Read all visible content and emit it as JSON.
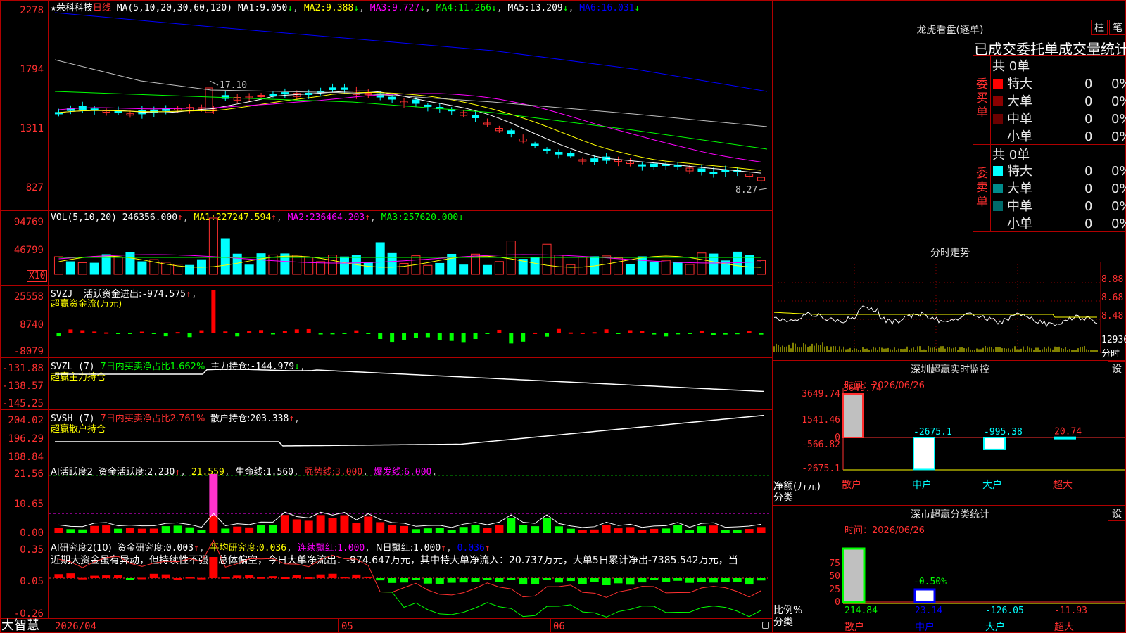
{
  "colors": {
    "up": "#ff3030",
    "down": "#00ffff",
    "flow_up": "#ff0000",
    "flow_down": "#00ff00",
    "ma1": "#ffffff",
    "ma2": "#ffff00",
    "ma3": "#ff00ff",
    "ma4": "#00ff00",
    "ma5": "#c0c0c0",
    "ma6": "#0000ff",
    "frame": "#b00000"
  },
  "kline": {
    "star": "★",
    "stock_name": "荣科科技",
    "period": "日线",
    "ma_title": "MA(5,10,20,30,60,120)",
    "ma": [
      {
        "label": "MA1:",
        "value": "9.050",
        "dir": "↓"
      },
      {
        "label": "MA2:",
        "value": "9.388",
        "dir": "↓"
      },
      {
        "label": "MA3:",
        "value": "9.727",
        "dir": "↓"
      },
      {
        "label": "MA4:",
        "value": "11.266",
        "dir": "↓"
      },
      {
        "label": "MA5:",
        "value": "13.209",
        "dir": "↓"
      },
      {
        "label": "MA6:",
        "value": "16.031",
        "dir": "↓"
      }
    ],
    "y_ticks": [
      "2278",
      "1794",
      "1311",
      "827"
    ],
    "annot_high": "17.10",
    "annot_low": "8.27"
  },
  "vol": {
    "title": "VOL(5,10,20)",
    "value": "246356.000",
    "dir": "↑",
    "ma": [
      {
        "label": "MA1:",
        "value": "227247.594",
        "dir": "↑"
      },
      {
        "label": "MA2:",
        "value": "236464.203",
        "dir": "↑"
      },
      {
        "label": "MA3:",
        "value": "257620.000",
        "dir": "↓"
      }
    ],
    "y_ticks": [
      "94769",
      "46799"
    ],
    "unit": "X10"
  },
  "svzj": {
    "title": "SVZJ",
    "name": "活跃资金进出:",
    "value": "-974.575",
    "dir": "↑",
    "subtitle": "超赢资金流(万元)",
    "y_ticks": [
      "25558",
      "8740",
      "-8079"
    ]
  },
  "svzl": {
    "title": "SVZL (7)",
    "l1": "7日内买卖净占比1.662%",
    "l2": "主力持仓:",
    "v2": "-144.979",
    "dir": "↓",
    "subtitle": "超赢主力持仓",
    "y_ticks": [
      "-131.88",
      "-138.57",
      "-145.25"
    ]
  },
  "svsh": {
    "title": "SVSH (7)",
    "l1": "7日内买卖净占比2.761%",
    "l2": "散户持仓:",
    "v2": "203.338",
    "dir": "↑",
    "subtitle": "超赢散户持仓",
    "y_ticks": [
      "204.02",
      "196.29",
      "188.84"
    ]
  },
  "ai_active": {
    "title": "AI活跃度2",
    "l1": "资金活跃度:",
    "v1": "2.230",
    "d1": "↑",
    "v2": "21.559",
    "l3": "生命线:",
    "v3": "1.560",
    "l4": "强势线:",
    "v4": "3.000",
    "l5": "爆发线:",
    "v5": "6.000",
    "y_ticks": [
      "21.56",
      "10.65",
      "0.00"
    ]
  },
  "ai_research": {
    "title": "AI研究度2(10)",
    "l1": "资金研究度:",
    "v1": "0.003",
    "d1": "↑",
    "l2": "平均研究度:",
    "v2": "0.036",
    "l3": "连续飘红:",
    "v3": "1.000",
    "l4": "N日飘红:",
    "v4": "1.000",
    "v5": "0.036",
    "d5": "↑",
    "comment": "近期大资金虽有异动，但持续性不强，总体偏空，今日大单净流出：-974.647万元，其中特大单净流入：20.737万元，大单5日累计净出-7385.542万元，当",
    "y_ticks": [
      "0.35",
      "0.05",
      "-0.26"
    ]
  },
  "date_axis": {
    "brand": "大智慧",
    "d1": "2026/04",
    "d2": "05",
    "d3": "06"
  },
  "lhb": {
    "title": "龙虎看盘(逐单)",
    "tab1": "柱",
    "tab2": "笔",
    "subtitle": "已成交委托单成交量统计",
    "buy_label": "委买单",
    "sell_label": "委卖单",
    "buy_total": "共 0单",
    "sell_total": "共 0单",
    "buy_rows": [
      {
        "name": "特大",
        "count": "0",
        "pct": "0%"
      },
      {
        "name": "大单",
        "count": "0",
        "pct": "0%"
      },
      {
        "name": "中单",
        "count": "0",
        "pct": "0%"
      },
      {
        "name": "小单",
        "count": "0",
        "pct": "0%"
      }
    ],
    "sell_rows": [
      {
        "name": "特大",
        "count": "0",
        "pct": "0%"
      },
      {
        "name": "大单",
        "count": "0",
        "pct": "0%"
      },
      {
        "name": "中单",
        "count": "0",
        "pct": "0%"
      },
      {
        "name": "小单",
        "count": "0",
        "pct": "0%"
      }
    ]
  },
  "intraday": {
    "title": "分时走势",
    "y_ticks": [
      "8.88",
      "8.68",
      "8.48",
      "12930"
    ],
    "unit": "分时"
  },
  "monitor": {
    "title": "深圳超赢实时监控",
    "set": "设",
    "time_label": "时间：",
    "time": "2026/06/26",
    "y_ticks": [
      "3649.74",
      "1541.46",
      "0",
      "-566.82",
      "-2675.1"
    ],
    "unit": "净额(万元)",
    "cat_label": "分类",
    "bars": [
      {
        "cat": "散户",
        "value": "3649.74"
      },
      {
        "cat": "中户",
        "value": "-2675.1"
      },
      {
        "cat": "大户",
        "value": "-995.38"
      },
      {
        "cat": "超大",
        "value": "20.74"
      }
    ]
  },
  "classify": {
    "title": "深市超赢分类统计",
    "set": "设",
    "time_label": "时间：",
    "time": "2026/06/26",
    "y_ticks": [
      "75",
      "50",
      "25",
      "0"
    ],
    "unit": "比例%",
    "cat_label": "分类",
    "pct_label": "-0.50%",
    "bars": [
      {
        "cat": "散户",
        "value": "214.84"
      },
      {
        "cat": "中户",
        "value": "23.14"
      },
      {
        "cat": "大户",
        "value": "-126.05"
      },
      {
        "cat": "超大",
        "value": "-11.93"
      }
    ]
  }
}
